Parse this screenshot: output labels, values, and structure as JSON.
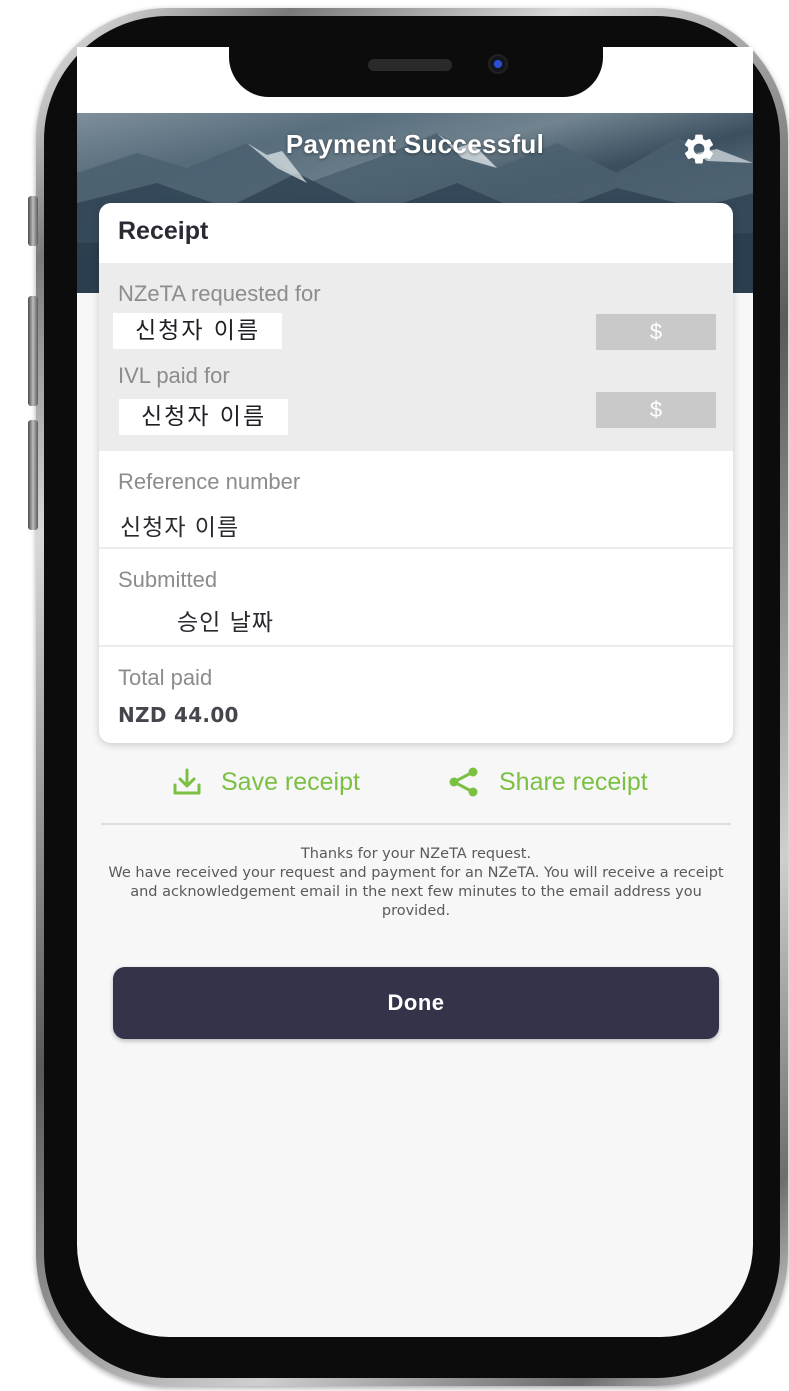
{
  "header": {
    "title": "Payment Successful",
    "settings_icon": "gear-icon"
  },
  "receipt": {
    "title": "Receipt",
    "requested_label": "NZeTA requested for",
    "requested_name": "신청자 이름",
    "requested_amount": "$",
    "ivl_label": "IVL paid for",
    "ivl_name": "신청자 이름",
    "ivl_amount": "$",
    "reference_label": "Reference number",
    "reference_value": "신청자 이름",
    "submitted_label": "Submitted",
    "submitted_value": "승인 날짜",
    "total_label": "Total paid",
    "total_value": "NZD 44.00"
  },
  "actions": {
    "save_label": "Save receipt",
    "save_icon": "download-icon",
    "share_label": "Share receipt",
    "share_icon": "share-icon",
    "accent_color": "#7bc043"
  },
  "message": {
    "line1": "Thanks for your NZeTA request.",
    "line2": "We have received your request and payment for an NZeTA. You will receive a receipt and acknowledgement email in the next few minutes to the email address you provided."
  },
  "done_label": "Done",
  "colors": {
    "button": "#33344a",
    "card": "#ffffff"
  }
}
